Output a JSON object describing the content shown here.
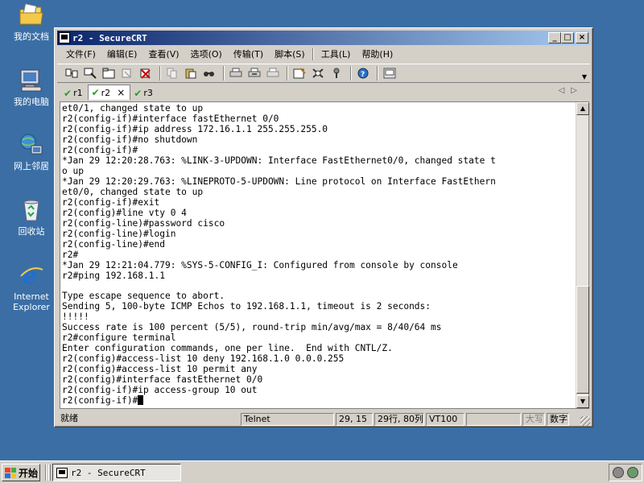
{
  "desktop": {
    "icons": [
      {
        "label": "我的文档",
        "icon": "folder-documents-icon"
      },
      {
        "label": "我的电脑",
        "icon": "computer-icon"
      },
      {
        "label": "网上邻居",
        "icon": "network-icon"
      },
      {
        "label": "回收站",
        "icon": "recycle-bin-icon"
      },
      {
        "label": "Internet Explorer",
        "icon": "internet-explorer-icon"
      }
    ]
  },
  "window": {
    "title": "r2 - SecureCRT",
    "controls": {
      "minimize": "_",
      "maximize": "□",
      "close": "×"
    }
  },
  "menu": {
    "file": "文件(F)",
    "edit": "编辑(E)",
    "view": "查看(V)",
    "options": "选项(O)",
    "transfer": "传输(T)",
    "script": "脚本(S)",
    "tools": "工具(L)",
    "help": "帮助(H)"
  },
  "tabs": [
    {
      "label": "r1",
      "active": false
    },
    {
      "label": "r2",
      "active": true
    },
    {
      "label": "r3",
      "active": false
    }
  ],
  "tab_close": "×",
  "tab_nav": "◁▷",
  "terminal": {
    "lines": [
      "et0/1, changed state to up",
      "r2(config-if)#interface fastEthernet 0/0",
      "r2(config-if)#ip address 172.16.1.1 255.255.255.0",
      "r2(config-if)#no shutdown",
      "r2(config-if)#",
      "*Jan 29 12:20:28.763: %LINK-3-UPDOWN: Interface FastEthernet0/0, changed state t",
      "o up",
      "*Jan 29 12:20:29.763: %LINEPROTO-5-UPDOWN: Line protocol on Interface FastEthern",
      "et0/0, changed state to up",
      "r2(config-if)#exit",
      "r2(config)#line vty 0 4",
      "r2(config-line)#password cisco",
      "r2(config-line)#login",
      "r2(config-line)#end",
      "r2#",
      "*Jan 29 12:21:04.779: %SYS-5-CONFIG_I: Configured from console by console",
      "r2#ping 192.168.1.1",
      "",
      "Type escape sequence to abort.",
      "Sending 5, 100-byte ICMP Echos to 192.168.1.1, timeout is 2 seconds:",
      "!!!!!",
      "Success rate is 100 percent (5/5), round-trip min/avg/max = 8/40/64 ms",
      "r2#configure terminal",
      "Enter configuration commands, one per line.  End with CNTL/Z.",
      "r2(config)#access-list 10 deny 192.168.1.0 0.0.0.255",
      "r2(config)#access-list 10 permit any",
      "r2(config)#interface fastEthernet 0/0",
      "r2(config-if)#ip access-group 10 out"
    ],
    "prompt": "r2(config-if)#"
  },
  "statusbar": {
    "ready": "就绪",
    "protocol": "Telnet",
    "position": "29, 15",
    "size": "29行, 80列",
    "emulation": "VT100",
    "caps": "大写",
    "num": "数字"
  },
  "taskbar": {
    "start": "开始",
    "task": "r2 - SecureCRT"
  },
  "colors": {
    "desktop": "#3a6ea5",
    "title_start": "#0a246a",
    "title_end": "#a6caf0",
    "tab_check": "#2a9d2a"
  }
}
